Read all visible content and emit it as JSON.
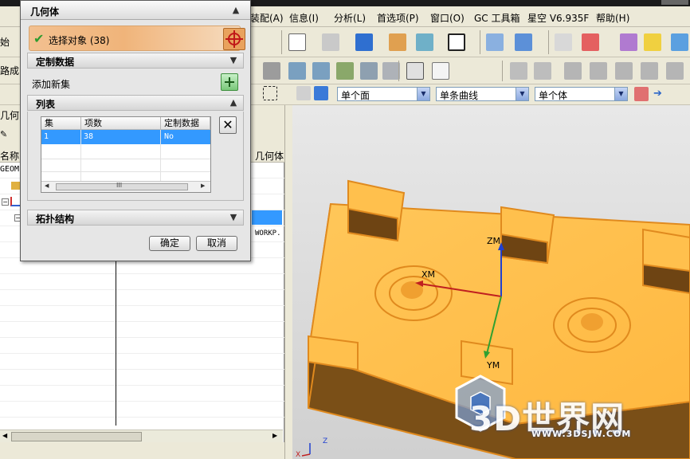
{
  "menubar": {
    "items": [
      "装配(A)",
      "信息(I)",
      "分析(L)",
      "首选项(P)",
      "窗口(O)",
      "GC 工具箱",
      "星空 V6.935F",
      "帮助(H)"
    ]
  },
  "toolbar": {
    "left_fragments": [
      "始",
      "路成"
    ],
    "combos": [
      {
        "value": "单个面"
      },
      {
        "value": "单条曲线"
      },
      {
        "value": "单个体"
      }
    ]
  },
  "navigator": {
    "title_fragment": "几何",
    "columns": [
      "名称",
      "几何体"
    ],
    "row_text_left": "GEOME",
    "row_text_right": "WORKP."
  },
  "dialog": {
    "title": "几何体",
    "select_object_label": "选择对象 (38)",
    "custom_data_header": "定制数据",
    "add_new_set_label": "添加新集",
    "list_header": "列表",
    "list_columns": [
      "集",
      "项数",
      "定制数据"
    ],
    "list_rows": [
      {
        "set": "1",
        "count": "38",
        "custom": "No"
      }
    ],
    "scroll_grip": "III",
    "topology_header": "拓扑结构",
    "ok_label": "确定",
    "cancel_label": "取消"
  },
  "viewport": {
    "axis_labels": {
      "zm": "ZM",
      "xm": "XM",
      "ym": "YM"
    },
    "triad_labels": {
      "z": "Z",
      "x": "X"
    },
    "watermark_text": "3D世界网",
    "watermark_url": "WWW.3DSJW.COM"
  },
  "colors": {
    "part_face": "#ffc04d",
    "part_side": "#7a4f17",
    "part_edge": "#e08a1e",
    "selection_blue": "#3399ff",
    "dialog_selected": "#f0b47a"
  }
}
